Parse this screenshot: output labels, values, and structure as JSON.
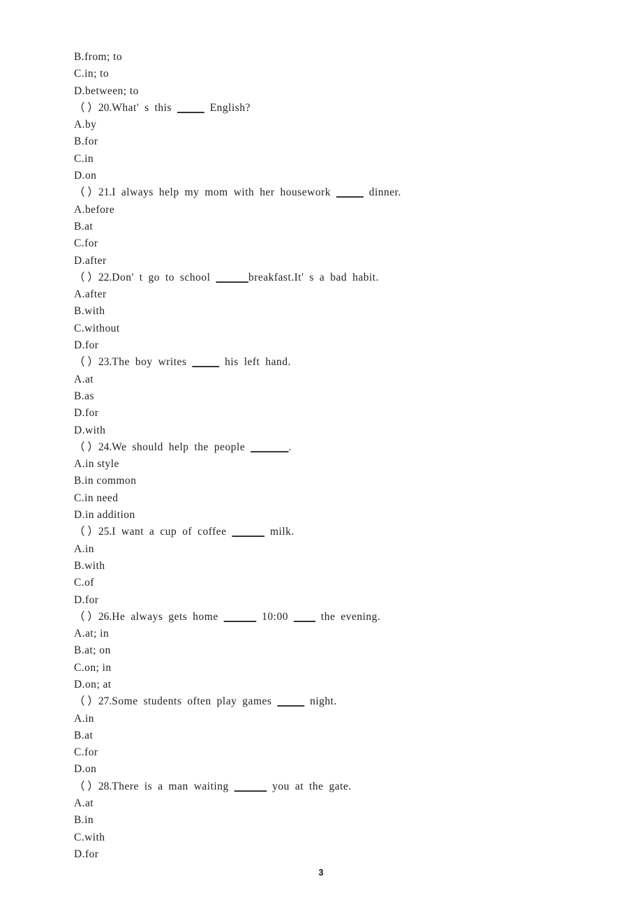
{
  "document": {
    "page_number": "3",
    "type": "english-grammar-multiple-choice-worksheet"
  },
  "lines": [
    {
      "kind": "option",
      "text": "B.from; to"
    },
    {
      "kind": "option",
      "text": "C.in; to"
    },
    {
      "kind": "option",
      "text": "D.between; to"
    },
    {
      "kind": "stem",
      "number": "20",
      "prefix": "（ ）20.",
      "before": "What' s this ",
      "blank": "_____",
      "after": " English?"
    },
    {
      "kind": "option",
      "text": "A.by"
    },
    {
      "kind": "option",
      "text": "B.for"
    },
    {
      "kind": "option",
      "text": "C.in"
    },
    {
      "kind": "option",
      "text": "D.on"
    },
    {
      "kind": "stem",
      "number": "21",
      "prefix": "（ ）21.",
      "before": "I always help my mom with her housework ",
      "blank": "_____",
      "after": " dinner."
    },
    {
      "kind": "option",
      "text": "A.before"
    },
    {
      "kind": "option",
      "text": "B.at"
    },
    {
      "kind": "option",
      "text": "C.for"
    },
    {
      "kind": "option",
      "text": "D.after"
    },
    {
      "kind": "stem",
      "number": "22",
      "prefix": "（ ）22.",
      "before": "Don' t go to school ",
      "blank": "______",
      "after": "breakfast.It' s a bad habit."
    },
    {
      "kind": "option",
      "text": "A.after"
    },
    {
      "kind": "option",
      "text": "B.with"
    },
    {
      "kind": "option",
      "text": "C.without"
    },
    {
      "kind": "option",
      "text": "D.for"
    },
    {
      "kind": "stem",
      "number": "23",
      "prefix": "（ ）23.",
      "before": "The boy writes ",
      "blank": "_____",
      "after": " his left hand."
    },
    {
      "kind": "option",
      "text": "A.at"
    },
    {
      "kind": "option",
      "text": "B.as"
    },
    {
      "kind": "option",
      "text": "D.for"
    },
    {
      "kind": "option",
      "text": "D.with"
    },
    {
      "kind": "stem",
      "number": "24",
      "prefix": "（ ）24.",
      "before": "We should help the people ",
      "blank": "_______",
      "after": "."
    },
    {
      "kind": "option",
      "text": "A.in style"
    },
    {
      "kind": "option",
      "text": "B.in common"
    },
    {
      "kind": "option",
      "text": "C.in need"
    },
    {
      "kind": "option",
      "text": "D.in addition"
    },
    {
      "kind": "stem",
      "number": "25",
      "prefix": "（ ）25.",
      "before": "I want a cup of coffee ",
      "blank": "______",
      "after": " milk."
    },
    {
      "kind": "option",
      "text": "A.in"
    },
    {
      "kind": "option",
      "text": "B.with"
    },
    {
      "kind": "option",
      "text": "C.of"
    },
    {
      "kind": "option",
      "text": "D.for"
    },
    {
      "kind": "stem",
      "number": "26",
      "prefix": "（ ）26.",
      "before": "He always gets home ",
      "blank": "______",
      "middle": " 10:00 ",
      "blank2": "____",
      "after": " the evening."
    },
    {
      "kind": "option",
      "text": "A.at; in"
    },
    {
      "kind": "option",
      "text": "B.at; on"
    },
    {
      "kind": "option",
      "text": "C.on; in"
    },
    {
      "kind": "option",
      "text": "D.on; at"
    },
    {
      "kind": "stem",
      "number": "27",
      "prefix": "（ ）27.",
      "before": "Some students often play games ",
      "blank": "_____",
      "after": " night."
    },
    {
      "kind": "option",
      "text": "A.in"
    },
    {
      "kind": "option",
      "text": "B.at"
    },
    {
      "kind": "option",
      "text": "C.for"
    },
    {
      "kind": "option",
      "text": "D.on"
    },
    {
      "kind": "stem",
      "number": "28",
      "prefix": "（ ）28.",
      "before": "There is a man waiting ",
      "blank": "______",
      "after": " you at the gate."
    },
    {
      "kind": "option",
      "text": "A.at"
    },
    {
      "kind": "option",
      "text": "B.in"
    },
    {
      "kind": "option",
      "text": "C.with"
    },
    {
      "kind": "option",
      "text": "D.for"
    }
  ]
}
